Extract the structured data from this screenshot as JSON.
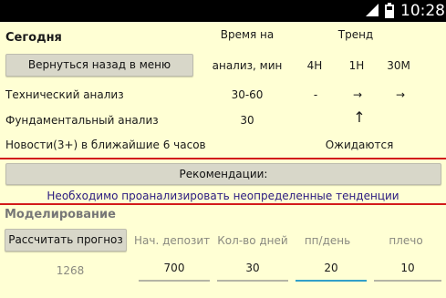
{
  "status_bar": {
    "time": "10:28",
    "network": "3G"
  },
  "header": {
    "today_label": "Сегодня",
    "time_col_label_1": "Время на",
    "time_col_label_2": "анализ, мин",
    "trend_label": "Тренд",
    "timeframes": [
      "4H",
      "1H",
      "30M"
    ]
  },
  "back_button_label": "Вернуться назад в меню",
  "rows": [
    {
      "label": "Технический анализ",
      "time": "30-60",
      "trend": [
        "-",
        "→",
        "→"
      ]
    },
    {
      "label": "Фундаментальный анализ",
      "time": "30",
      "trend_1h": "↑"
    },
    {
      "label": "Новости(3+) в ближайшие 6 часов",
      "status": "Ожидаются"
    }
  ],
  "recommendations": {
    "button_label": "Рекомендации:",
    "text": "Необходимо проанализировать неопределенные тенденции"
  },
  "modeling": {
    "title": "Моделирование",
    "calc_button_label": "Рассчитать прогноз",
    "result_value": "1268",
    "columns": [
      {
        "label": "Нач. депозит",
        "value": "700"
      },
      {
        "label": "Кол-во дней",
        "value": "30"
      },
      {
        "label": "пп/день",
        "value": "20"
      },
      {
        "label": "плечо",
        "value": "10"
      }
    ]
  },
  "colors": {
    "background": "#ffffd4",
    "divider": "#d21a1a",
    "focus_underline": "#33a0c8",
    "link_text": "#2a1a80"
  }
}
